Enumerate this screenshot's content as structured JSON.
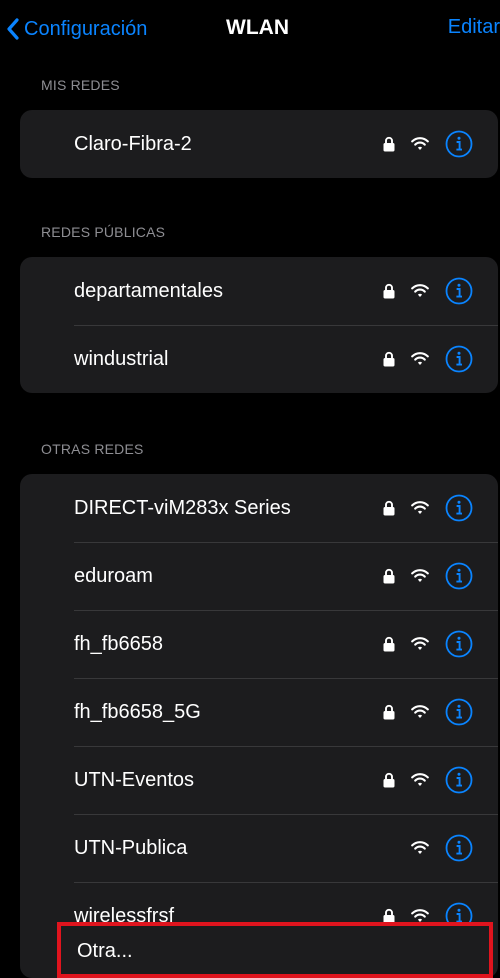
{
  "nav": {
    "back_label": "Configuración",
    "title": "WLAN",
    "edit_label": "Editar"
  },
  "colors": {
    "accent": "#0a84ff",
    "background": "#000000",
    "group_background": "#1c1c1e",
    "highlight_border": "#e0141e"
  },
  "sections": {
    "mine": {
      "header": "MIS REDES",
      "networks": [
        {
          "name": "Claro-Fibra-2",
          "locked": true
        }
      ]
    },
    "public": {
      "header": "REDES PÚBLICAS",
      "networks": [
        {
          "name": "departamentales",
          "locked": true
        },
        {
          "name": "windustrial",
          "locked": true
        }
      ]
    },
    "other": {
      "header": "OTRAS REDES",
      "networks": [
        {
          "name": "DIRECT-viM283x Series",
          "locked": true
        },
        {
          "name": "eduroam",
          "locked": true
        },
        {
          "name": "fh_fb6658",
          "locked": true
        },
        {
          "name": "fh_fb6658_5G",
          "locked": true
        },
        {
          "name": "UTN-Eventos",
          "locked": true
        },
        {
          "name": "UTN-Publica",
          "locked": false
        },
        {
          "name": "wirelessfrsf",
          "locked": true
        }
      ],
      "other_label": "Otra..."
    }
  },
  "icons": {
    "back": "chevron-left-icon",
    "lock": "lock-icon",
    "wifi": "wifi-icon",
    "info": "info-icon"
  }
}
